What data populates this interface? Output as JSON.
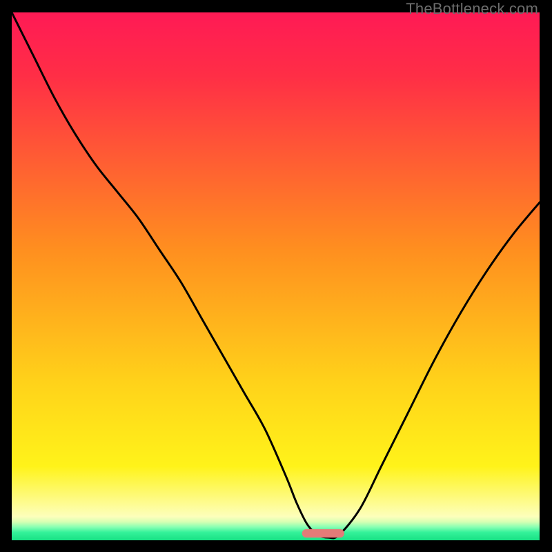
{
  "watermark": "TheBottleneck.com",
  "colors": {
    "gradient_stops": [
      {
        "offset": 0.0,
        "color": "#ff1a55"
      },
      {
        "offset": 0.12,
        "color": "#ff2e46"
      },
      {
        "offset": 0.45,
        "color": "#ff8f1f"
      },
      {
        "offset": 0.7,
        "color": "#ffd21a"
      },
      {
        "offset": 0.86,
        "color": "#fff31a"
      },
      {
        "offset": 0.955,
        "color": "#fdffbb"
      },
      {
        "offset": 0.965,
        "color": "#d8ffb3"
      },
      {
        "offset": 0.975,
        "color": "#87ffb3"
      },
      {
        "offset": 0.985,
        "color": "#34f29a"
      },
      {
        "offset": 1.0,
        "color": "#18e184"
      }
    ],
    "curve": "#000000",
    "marker": "#e37b78"
  },
  "chart_data": {
    "type": "line",
    "title": "",
    "xlabel": "",
    "ylabel": "",
    "xlim": [
      0,
      100
    ],
    "ylim": [
      0,
      100
    ],
    "grid": false,
    "x": [
      0,
      4,
      8,
      12,
      16,
      20,
      24,
      28,
      32,
      36,
      40,
      44,
      48,
      52,
      54,
      56,
      58,
      60,
      62,
      66,
      70,
      75,
      80,
      85,
      90,
      95,
      100
    ],
    "values": [
      100,
      92,
      84,
      77,
      71,
      66,
      61,
      55,
      49,
      42,
      35,
      28,
      21,
      12,
      7,
      3,
      1,
      0.5,
      1,
      6,
      14,
      24,
      34,
      43,
      51,
      58,
      64
    ],
    "optimum_marker": {
      "x_center": 59,
      "width_pct": 8,
      "height_pct": 1.6,
      "y_bottom_pct": 0.5
    }
  }
}
